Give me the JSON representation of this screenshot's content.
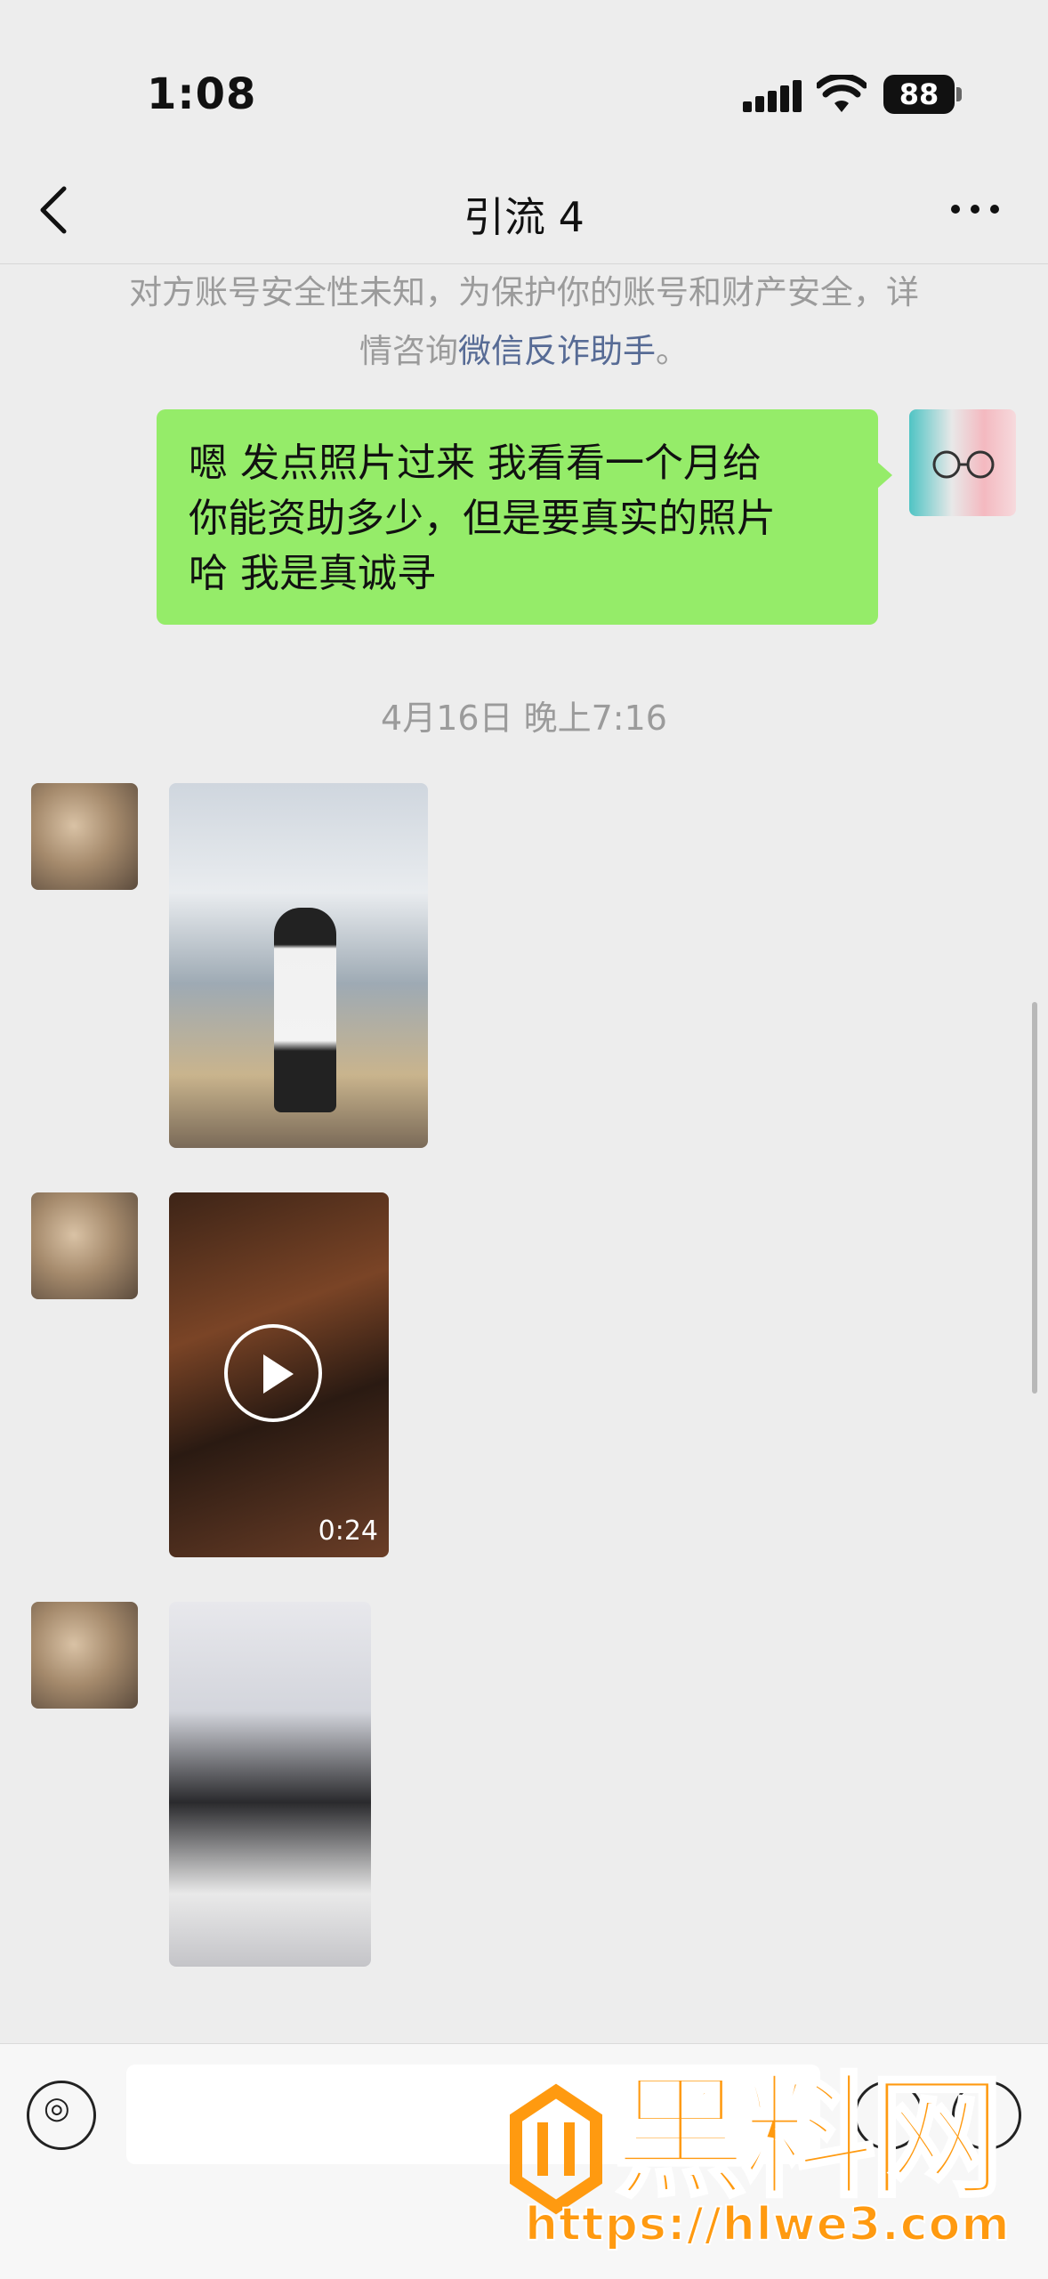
{
  "status_bar": {
    "time": "1:08",
    "battery": "88"
  },
  "nav": {
    "title": "引流 4"
  },
  "notice": {
    "line1": "对方账号安全性未知，为保护你的账号和财产安全，详",
    "line2_prefix": "情咨询",
    "link": "微信反诈助手",
    "line2_suffix": "。"
  },
  "messages": {
    "outgoing": {
      "line1": "嗯  发点照片过来 我看看一个月给",
      "line2": "你能资助多少，但是要真实的照片",
      "line3": "哈 我是真诚寻"
    },
    "timestamp": "4月16日 晚上7:16",
    "video_duration": "0:24"
  },
  "watermark": {
    "title": "黑料网",
    "url": "https://hlwe3.com"
  },
  "colors": {
    "bubble_out": "#95ec69",
    "background": "#ededed",
    "link": "#576b95",
    "watermark": "#ff9a10"
  }
}
